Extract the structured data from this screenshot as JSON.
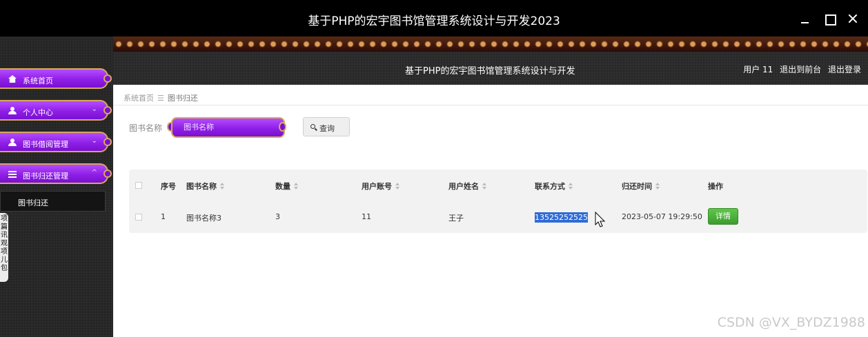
{
  "window": {
    "title": "基于PHP的宏宇图书馆管理系统设计与开发2023"
  },
  "sidebar": {
    "items": [
      {
        "label": "系统首页",
        "icon": "home-icon"
      },
      {
        "label": "个人中心",
        "icon": "user-icon",
        "chevron": "⌄"
      },
      {
        "label": "图书借阅管理",
        "icon": "user-icon",
        "chevron": "⌄"
      },
      {
        "label": "图书归还管理",
        "icon": "list-icon",
        "chevron": "^"
      }
    ],
    "subitem": "图书归还",
    "popup_text": "项\n篇\n讯\n观\n项\n儿\n包"
  },
  "header": {
    "title": "基于PHP的宏宇图书馆管理系统设计与开发",
    "user": "用户 11",
    "back_front": "退出到前台",
    "logout": "退出登录"
  },
  "breadcrumb": {
    "home": "系统首页",
    "sep": "☰",
    "current": "图书归还"
  },
  "search": {
    "label": "图书名称",
    "placeholder": "图书名称",
    "button": "查询"
  },
  "table": {
    "headers": [
      "序号",
      "图书名称",
      "数量",
      "用户账号",
      "用户姓名",
      "联系方式",
      "归还时间",
      "操作"
    ],
    "rows": [
      {
        "index": "1",
        "book_name": "图书名称3",
        "quantity": "3",
        "account": "11",
        "name": "王子",
        "contact": "13525252525",
        "return_time": "2023-05-07 19:29:50",
        "action": "详情"
      }
    ]
  },
  "colors": {
    "accent": "#8f1fe6",
    "gold_border": "#d7a85f",
    "detail_button": "#3d9c2e",
    "selection": "#2f6bd6"
  },
  "watermark": "CSDN @VX_BYDZ1988"
}
